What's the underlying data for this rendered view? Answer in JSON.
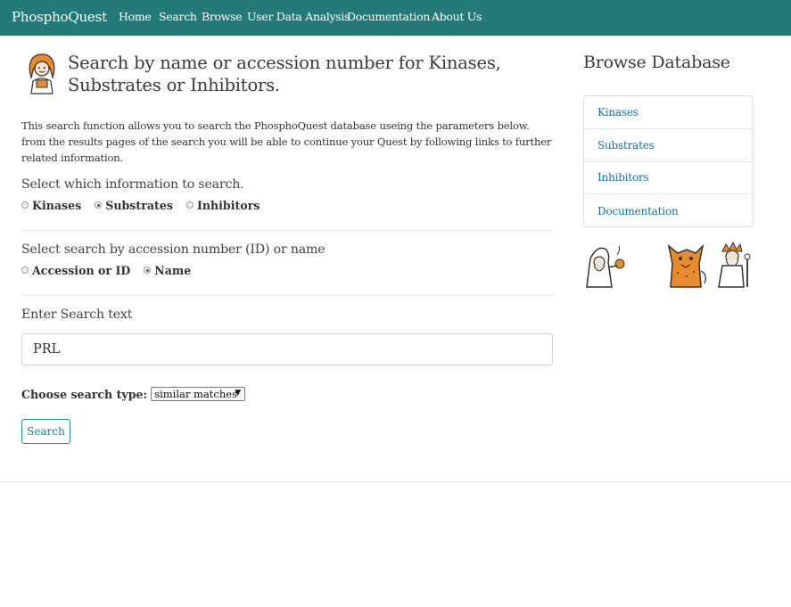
{
  "navbar": {
    "brand": "PhosphoQuest",
    "items": [
      {
        "label": "Home"
      },
      {
        "label": "Search"
      },
      {
        "label": "Browse"
      },
      {
        "label": "User Data Analysis"
      },
      {
        "label": "Documentation"
      },
      {
        "label": "About Us"
      }
    ]
  },
  "header": {
    "title": "Search by name or accession number for Kinases, Substrates or Inhibitors.",
    "icon": "scientist-avatar-icon"
  },
  "intro": "This search function allows you to search the PhosphoQuest database useing the parameters below. from the results pages of the search you will be able to continue your Quest by following links to further related information.",
  "info_section": {
    "label": "Select which information to search.",
    "options": [
      "Kinases",
      "Substrates",
      "Inhibitors"
    ],
    "selected": "Substrates"
  },
  "by_section": {
    "label": "Select search by accession number (ID) or name",
    "options": [
      "Accession or ID",
      "Name"
    ],
    "selected": "Name"
  },
  "search_text": {
    "label": "Enter Search text",
    "value": "PRL"
  },
  "search_type": {
    "label": "Choose search type:",
    "selected": "similar matches"
  },
  "search_button": "Search",
  "sidebar": {
    "title": "Browse Database",
    "items": [
      {
        "label": "Kinases"
      },
      {
        "label": "Substrates"
      },
      {
        "label": "Inhibitors"
      },
      {
        "label": "Documentation"
      }
    ],
    "mascots": [
      "wizard-mascot-icon",
      "fox-monster-mascot-icon",
      "old-wizard-mascot-icon"
    ]
  },
  "colors": {
    "navbar": "#237a78",
    "link": "#1a6fa8",
    "button_border": "#1f8b8e",
    "mascot_orange": "#e88a2e"
  }
}
